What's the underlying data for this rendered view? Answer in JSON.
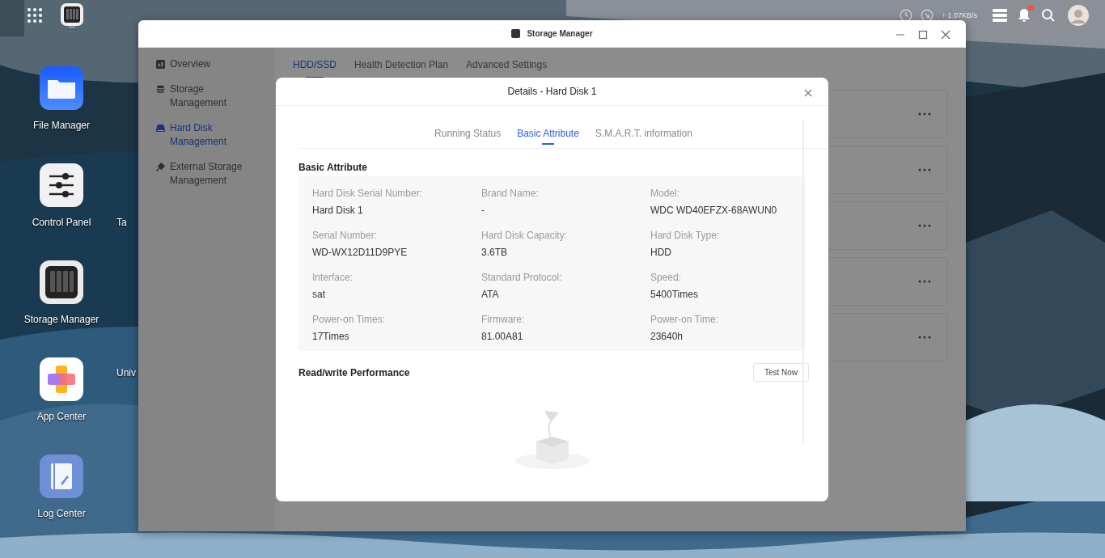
{
  "topbar": {
    "net_speed": "↑ 1.07KB/s",
    "notification_unread": true
  },
  "desktop_icons": [
    {
      "label": "File Manager",
      "kind": "files"
    },
    {
      "label": "Control Panel",
      "kind": "control"
    },
    {
      "label": "Storage Manager",
      "kind": "storage"
    },
    {
      "label": "App Center",
      "kind": "apps"
    },
    {
      "label": "Log Center",
      "kind": "log"
    }
  ],
  "desktop_partial_labels": [
    "Ta",
    "Univ"
  ],
  "window": {
    "title": "Storage Manager",
    "sidebar": [
      {
        "label": "Overview",
        "kind": "overview",
        "selected": false
      },
      {
        "label": "Storage Management",
        "kind": "storage",
        "selected": false
      },
      {
        "label": "Hard Disk Management",
        "kind": "disk",
        "selected": true
      },
      {
        "label": "External Storage Management",
        "kind": "external",
        "selected": false
      }
    ],
    "tabs": [
      {
        "label": "HDD/SSD",
        "selected": true
      },
      {
        "label": "Health Detection Plan",
        "selected": false
      },
      {
        "label": "Advanced Settings",
        "selected": false
      }
    ]
  },
  "dialog": {
    "title": "Details - Hard Disk 1",
    "tabs": [
      {
        "label": "Running Status",
        "selected": false
      },
      {
        "label": "Basic Attribute",
        "selected": true
      },
      {
        "label": "S.M.A.R.T. information",
        "selected": false
      }
    ],
    "section_title": "Basic Attribute",
    "attributes": [
      {
        "label": "Hard Disk Serial Number:",
        "value": "Hard Disk 1"
      },
      {
        "label": "Brand Name:",
        "value": "-"
      },
      {
        "label": "Model:",
        "value": "WDC WD40EFZX-68AWUN0"
      },
      {
        "label": "Serial Number:",
        "value": "WD-WX12D11D9PYE"
      },
      {
        "label": "Hard Disk Capacity:",
        "value": "3.6TB"
      },
      {
        "label": "Hard Disk Type:",
        "value": "HDD"
      },
      {
        "label": "Interface:",
        "value": "sat"
      },
      {
        "label": "Standard Protocol:",
        "value": "ATA"
      },
      {
        "label": "Speed:",
        "value": "5400Times"
      },
      {
        "label": "Power-on Times:",
        "value": "17Times"
      },
      {
        "label": "Firmware:",
        "value": "81.00A81"
      },
      {
        "label": "Power-on Time:",
        "value": "23640h"
      }
    ],
    "performance_title": "Read/write Performance",
    "test_button": "Test Now"
  }
}
